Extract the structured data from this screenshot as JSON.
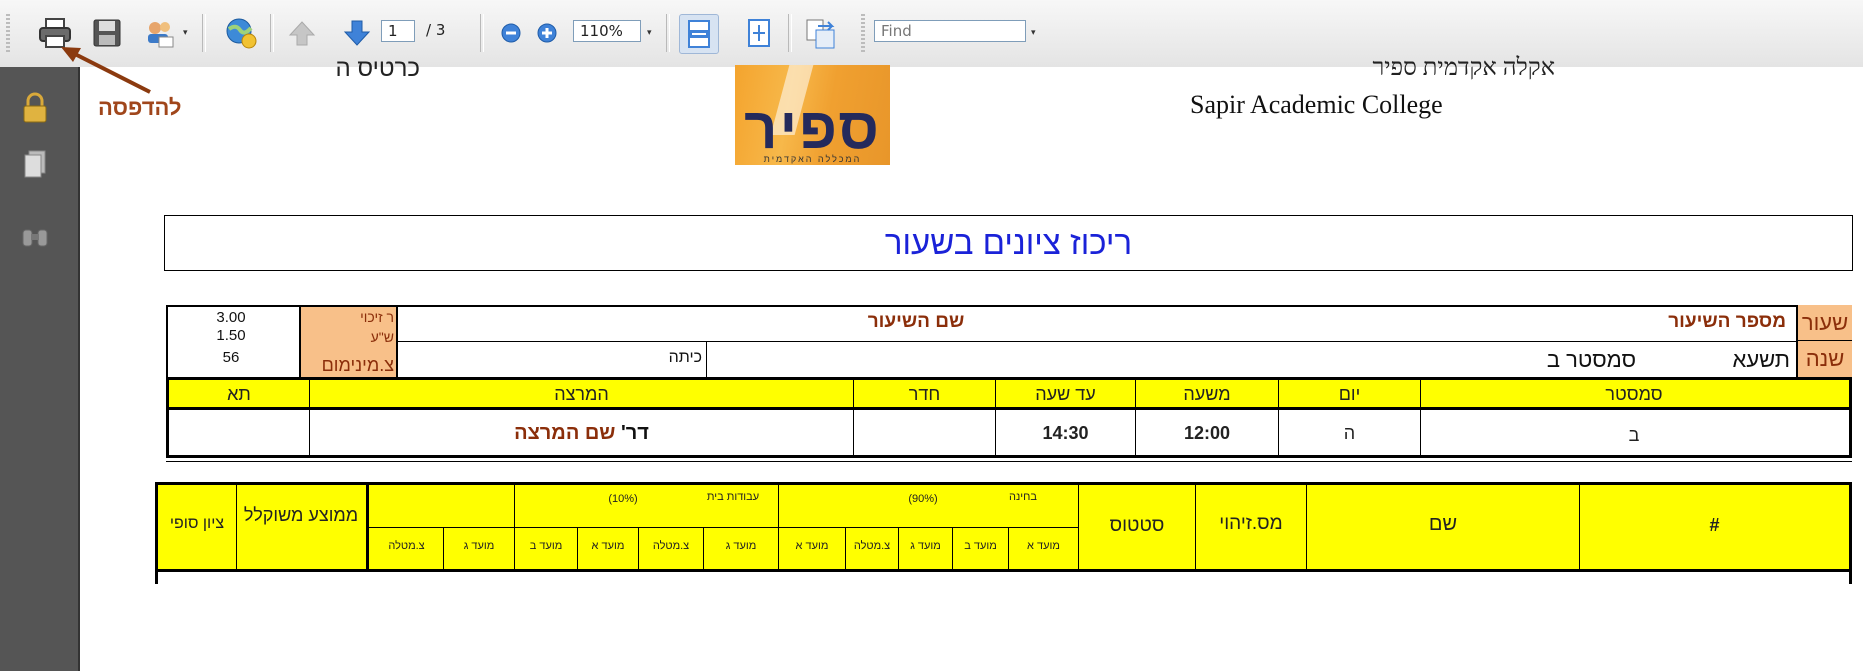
{
  "toolbar": {
    "page_input": "1",
    "page_total": "/ 3",
    "zoom_value": "110%",
    "find_placeholder": "Find",
    "dropdown_glyph": "▾"
  },
  "annotation": {
    "print_label": "להדפסה"
  },
  "header": {
    "top_right_partial": "אקלה אקדמית ספיר",
    "top_left_partial": "כרטיס ה",
    "college_en": "Sapir Academic College",
    "logo_main": "ספיר",
    "logo_sub": "המכללה האקדמית"
  },
  "title": "ריכוז ציונים בשעור",
  "course": {
    "label_course": "שעור",
    "label_year": "שנה",
    "course_number_label": "מספר השיעור",
    "course_name_label": "שם השיעור",
    "year_value": "תשעא",
    "semester_value": "סמסטר ב",
    "class_label": "כיתה",
    "credits_label": "ר זיכוי",
    "hours_label": "ש\"ע",
    "min_grade_label": "צ.מינימום",
    "credits_value": "3.00",
    "hours_value": "1.50",
    "min_grade_value": "56"
  },
  "schedule": {
    "headers": [
      "סמסטר",
      "יום",
      "משעה",
      "עד שעה",
      "חדר",
      "המרצה",
      "תא"
    ],
    "row": [
      "ב",
      "ה",
      "12:00",
      "14:30",
      "",
      "",
      ""
    ],
    "lecturer_prefix": "דר'",
    "lecturer_name": "שם המרצה"
  },
  "grades": {
    "col_index": "#",
    "col_name": "שם",
    "col_id": "מס.זיהוי",
    "col_status": "סטטוס",
    "exam_group": "בחינה",
    "exam_weight": "(90%)",
    "hw_group": "עבודות בית",
    "hw_weight": "(10%)",
    "col_weighted_avg": "ממוצע משוקלל",
    "col_final": "ציון סופי",
    "sub_a": "מועד א",
    "sub_b": "מועד ב",
    "sub_c": "מועד ג",
    "sub_weighted": "צ.מטלה"
  }
}
